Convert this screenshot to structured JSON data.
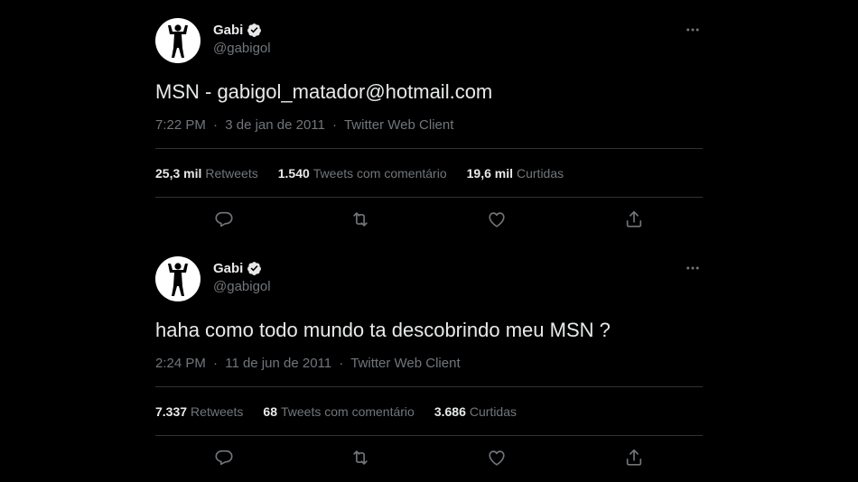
{
  "tweets": [
    {
      "display_name": "Gabi",
      "handle": "@gabigol",
      "text": "MSN - gabigol_matador@hotmail.com",
      "time": "7:22 PM",
      "date": "3 de jan de 2011",
      "client": "Twitter Web Client",
      "separator": "·",
      "stats": [
        {
          "num": "25,3 mil",
          "label": "Retweets"
        },
        {
          "num": "1.540",
          "label": "Tweets com comentário"
        },
        {
          "num": "19,6 mil",
          "label": "Curtidas"
        }
      ]
    },
    {
      "display_name": "Gabi",
      "handle": "@gabigol",
      "text": "haha como todo mundo ta descobrindo meu MSN ?",
      "time": "2:24 PM",
      "date": "11 de jun de 2011",
      "client": "Twitter Web Client",
      "separator": "·",
      "stats": [
        {
          "num": "7.337",
          "label": "Retweets"
        },
        {
          "num": "68",
          "label": "Tweets com comentário"
        },
        {
          "num": "3.686",
          "label": "Curtidas"
        }
      ]
    }
  ],
  "icons": {
    "verified": "verified-badge-icon",
    "more": "more-options-icon",
    "reply": "reply-icon",
    "retweet": "retweet-icon",
    "like": "heart-icon",
    "share": "share-icon"
  },
  "colors": {
    "background": "#000000",
    "text_primary": "#e7e9ea",
    "text_secondary": "#71767b",
    "divider": "#2f3336"
  }
}
